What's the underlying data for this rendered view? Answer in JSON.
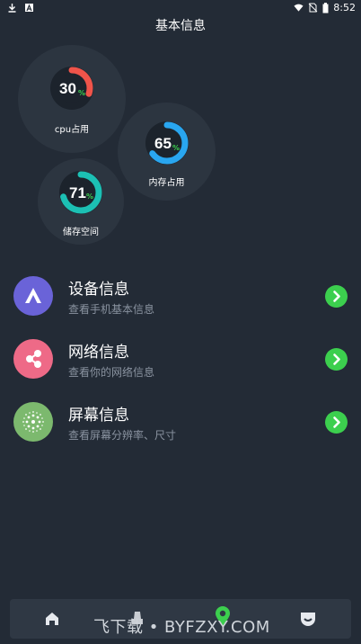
{
  "status_bar": {
    "time": "8:52",
    "icons": [
      "download-icon",
      "a-badge-icon",
      "wifi-icon",
      "no-sim-icon",
      "battery-icon"
    ]
  },
  "header": {
    "title": "基本信息"
  },
  "gauges": [
    {
      "id": "cpu",
      "value": "30",
      "percent_symbol": "%",
      "label": "cpu占用",
      "fraction": 0.3,
      "color": "#f0544a"
    },
    {
      "id": "memory",
      "value": "65",
      "percent_symbol": "%",
      "label": "内存占用",
      "fraction": 0.65,
      "color": "#29a6f0"
    },
    {
      "id": "storage",
      "value": "71",
      "percent_symbol": "%",
      "label": "储存空间",
      "fraction": 0.71,
      "color": "#1cc0b4"
    }
  ],
  "info_items": [
    {
      "title": "设备信息",
      "subtitle": "查看手机基本信息",
      "icon": "device-triangle-icon",
      "icon_color": "#6a63d8"
    },
    {
      "title": "网络信息",
      "subtitle": "查看你的网络信息",
      "icon": "network-nodes-icon",
      "icon_color": "#ee6a87"
    },
    {
      "title": "屏幕信息",
      "subtitle": "查看屏幕分辨率、尺寸",
      "icon": "screen-dots-icon",
      "icon_color": "#7cb96e"
    }
  ],
  "bottom_nav": {
    "items": [
      "home-icon",
      "tools-icon",
      "location-pin-icon",
      "profile-icon"
    ],
    "active": "location-pin-icon"
  },
  "watermark": "飞下载 • BYFZXY.COM",
  "colors": {
    "background": "#232b36",
    "card": "#2c3540",
    "arrow": "#3ccf4e",
    "subtitle": "#8a93a0"
  }
}
